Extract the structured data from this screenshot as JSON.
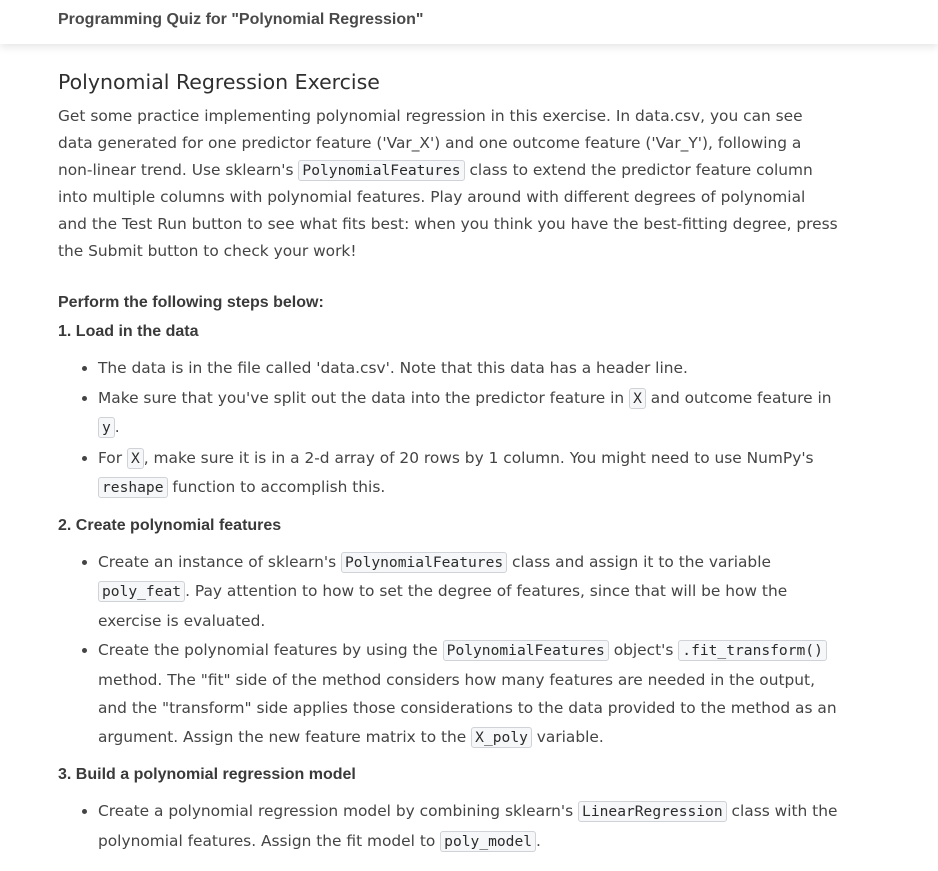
{
  "header": {
    "quiz_title": "Programming Quiz for \"Polynomial Regression\""
  },
  "intro": {
    "heading": "Polynomial Regression Exercise",
    "p1": "Get some practice implementing polynomial regression in this exercise. In data.csv, you can see data generated for one predictor feature ('Var_X') and one outcome feature ('Var_Y'), following a non-linear trend. Use sklearn's ",
    "code1": "PolynomialFeatures",
    "p2": " class to extend the predictor feature column into multiple columns with polynomial features. Play around with different degrees of polynomial and the Test Run button to see what fits best: when you think you have the best-fitting degree, press the Submit button to check your work!"
  },
  "steps_heading": "Perform the following steps below:",
  "step1": {
    "heading": "1. Load in the data",
    "b1": "The data is in the file called 'data.csv'. Note that this data has a header line.",
    "b2_a": "Make sure that you've split out the data into the predictor feature in ",
    "b2_code1": "X",
    "b2_b": " and outcome feature in ",
    "b2_code2": "y",
    "b2_c": ".",
    "b3_a": "For ",
    "b3_code1": "X",
    "b3_b": ", make sure it is in a 2-d array of 20 rows by 1 column. You might need to use NumPy's ",
    "b3_code2": "reshape",
    "b3_c": " function to accomplish this."
  },
  "step2": {
    "heading": "2. Create polynomial features",
    "b1_a": "Create an instance of sklearn's ",
    "b1_code1": "PolynomialFeatures",
    "b1_b": " class and assign it to the variable ",
    "b1_code2": "poly_feat",
    "b1_c": ". Pay attention to how to set the degree of features, since that will be how the exercise is evaluated.",
    "b2_a": "Create the polynomial features by using the ",
    "b2_code1": "PolynomialFeatures",
    "b2_b": " object's ",
    "b2_code2": ".fit_transform()",
    "b2_c": " method. The \"fit\" side of the method considers how many features are needed in the output, and the \"transform\" side applies those considerations to the data provided to the method as an argument. Assign the new feature matrix to the ",
    "b2_code3": "X_poly",
    "b2_d": " variable."
  },
  "step3": {
    "heading": "3. Build a polynomial regression model",
    "b1_a": "Create a polynomial regression model by combining sklearn's ",
    "b1_code1": "LinearRegression",
    "b1_b": " class with the polynomial features. Assign the fit model to ",
    "b1_code2": "poly_model",
    "b1_c": "."
  }
}
